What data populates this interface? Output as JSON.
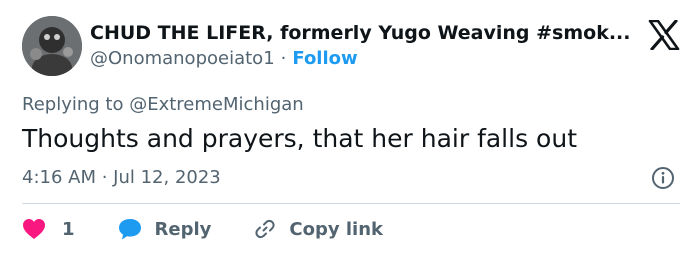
{
  "author": {
    "display_name": "CHUD THE LIFER, formerly Yugo Weaving #smok...",
    "handle": "@Onomanopoeiato1",
    "separator": "·",
    "follow_label": "Follow"
  },
  "header": {
    "logo_icon": "x-logo-icon"
  },
  "tweet": {
    "replying_prefix": "Replying to",
    "replying_to": "@ExtremeMichigan",
    "text": "Thoughts and prayers, that her hair falls out",
    "timestamp": "4:16 AM · Jul 12, 2023"
  },
  "actions": {
    "like_count": "1",
    "reply_label": "Reply",
    "copy_link_label": "Copy link"
  },
  "colors": {
    "accent": "#1d9bf0",
    "like": "#f91880",
    "secondary_text": "#536471",
    "divider": "#cfd9de"
  }
}
